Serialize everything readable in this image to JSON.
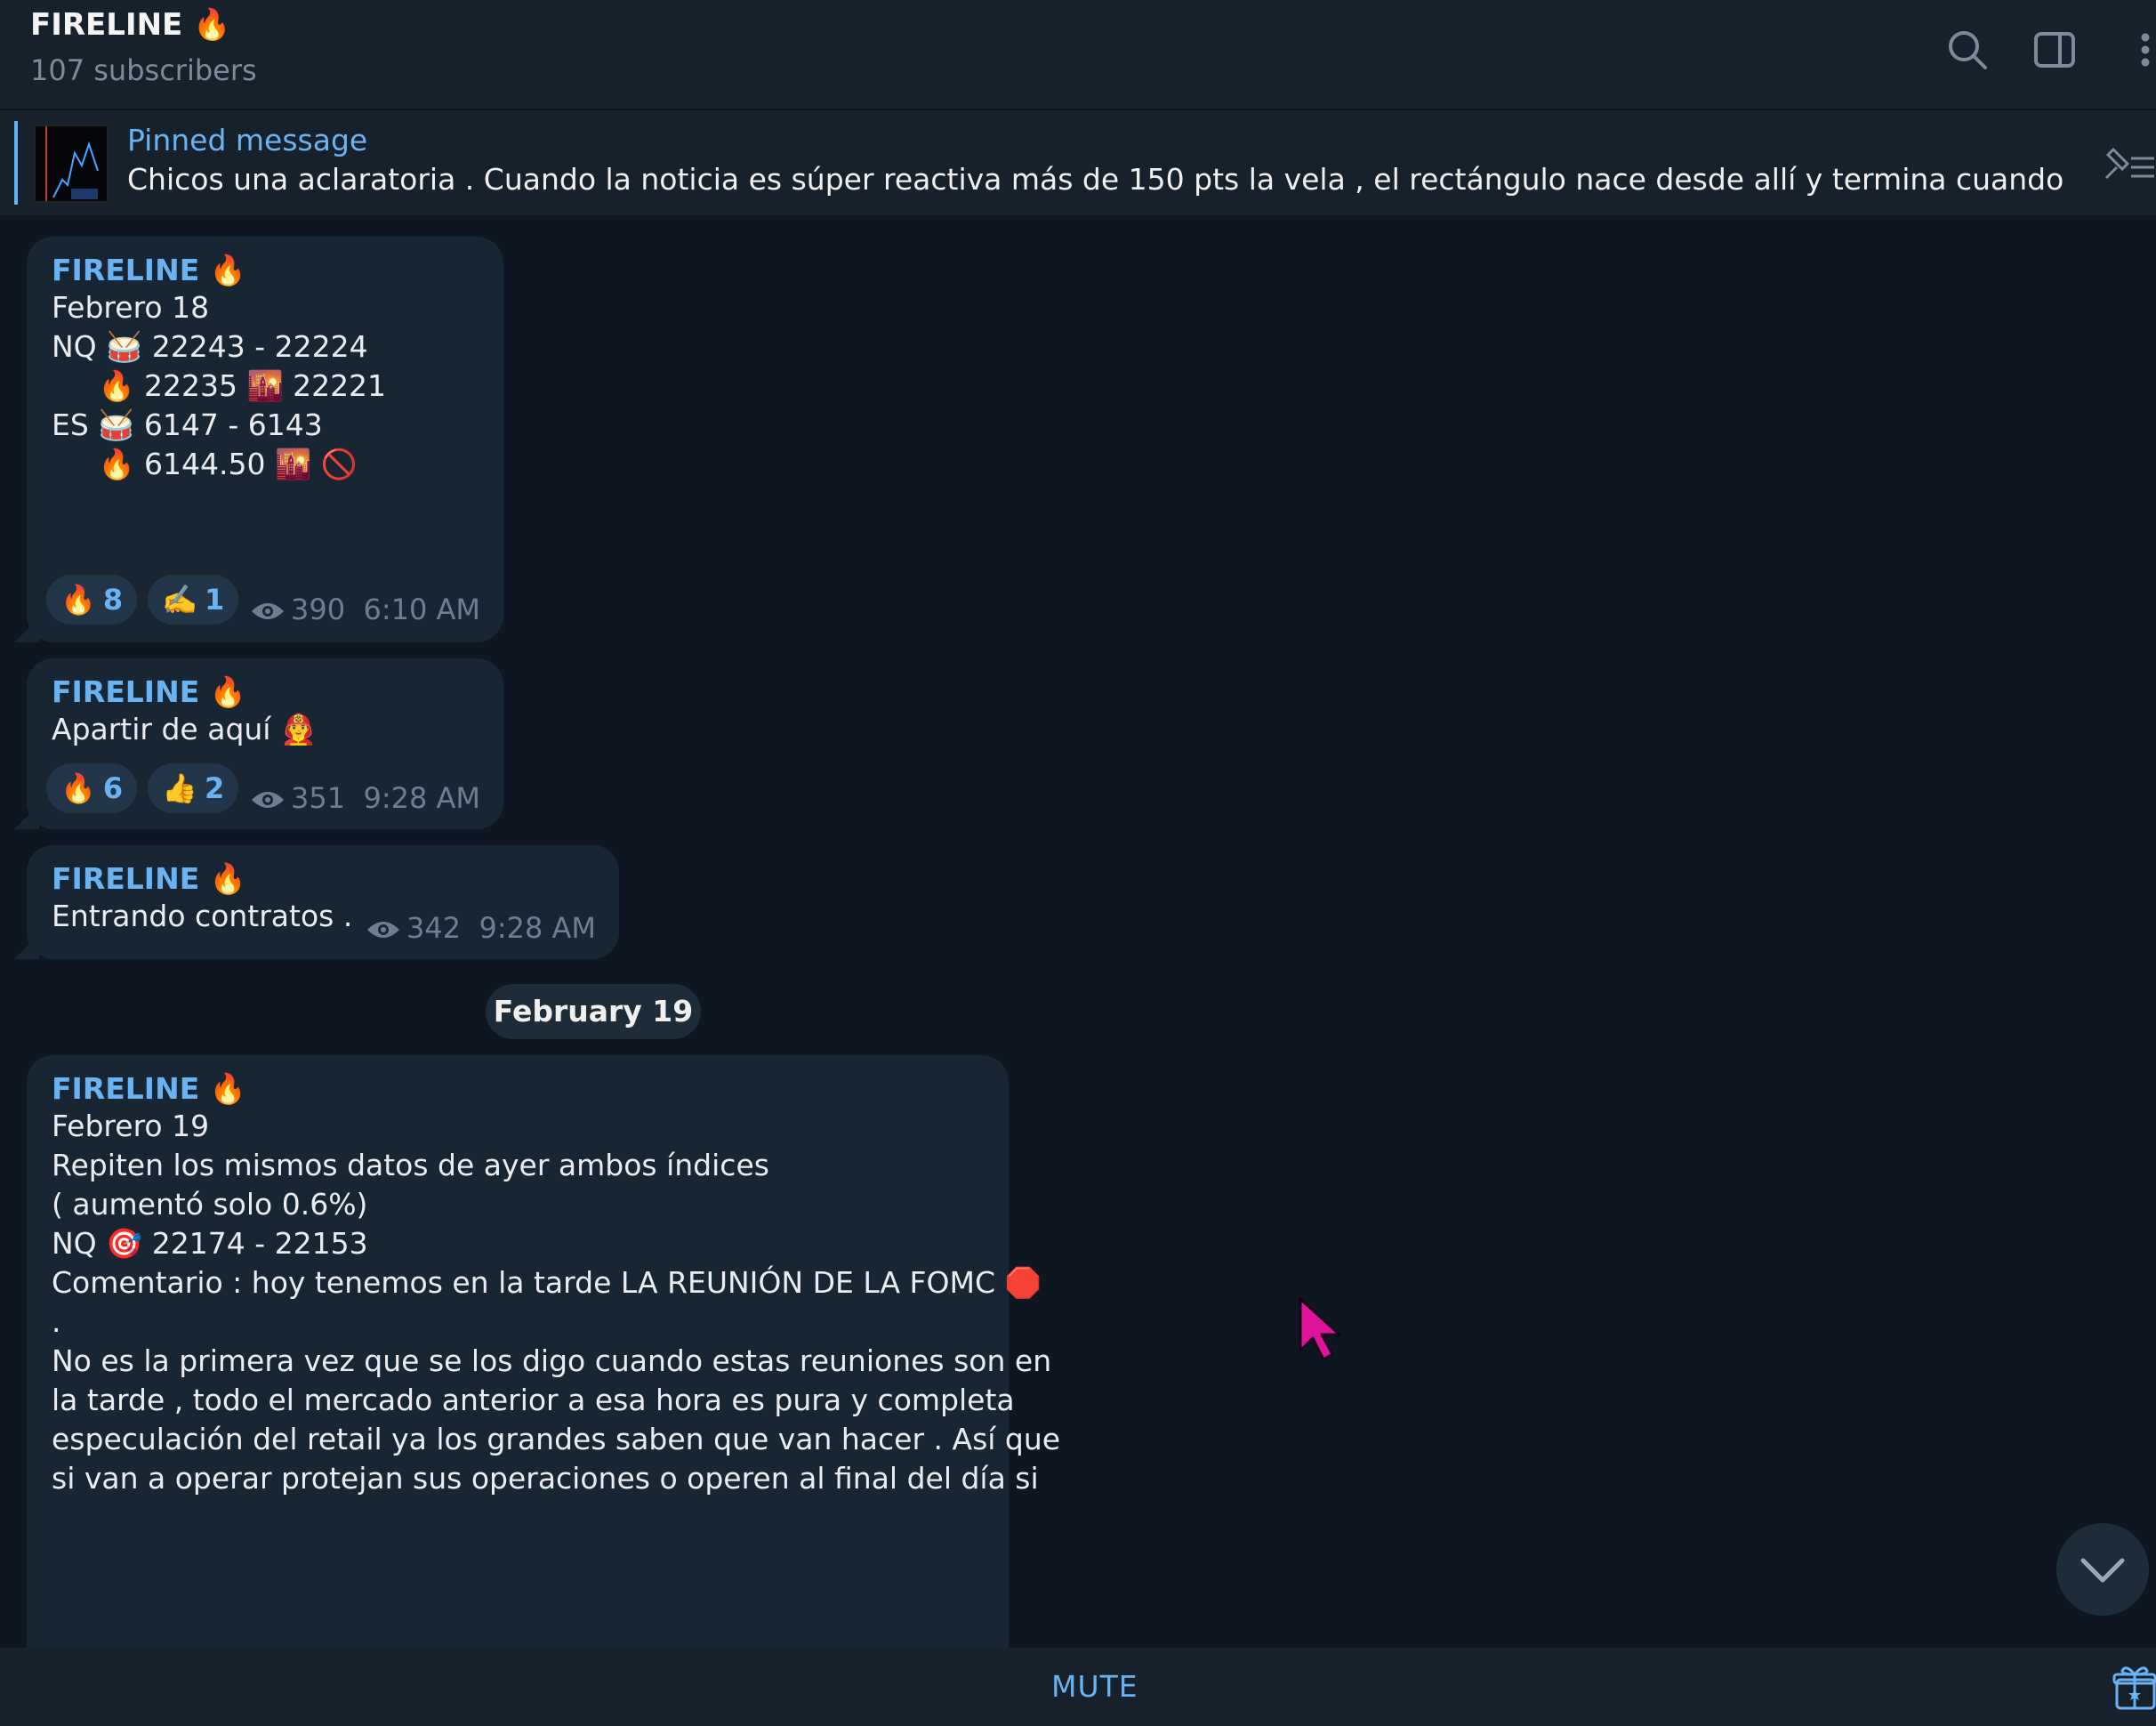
{
  "header": {
    "title": "FIRELINE 🔥",
    "subtitle": "107 subscribers",
    "icons": [
      "search-icon",
      "sidebar-toggle-icon",
      "more-vertical-icon"
    ]
  },
  "pinned": {
    "label": "Pinned message",
    "text": "Chicos una aclaratoria .  Cuando la noticia es súper reactiva más de 150 pts la vela , el rectángulo nace desde allí y termina cuando complete las..."
  },
  "messages": [
    {
      "author": "FIRELINE 🔥",
      "lines": [
        "Febrero 18",
        "",
        "NQ 🥁 22243 - 22224",
        "     🔥 22235 🌇 22221",
        "",
        "ES 🥁 6147 - 6143",
        "     🔥 6144.50 🌇 🚫"
      ],
      "reactions": [
        {
          "emoji": "🔥",
          "count": "8"
        },
        {
          "emoji": "✍️",
          "count": "1"
        }
      ],
      "views": "390",
      "time": "6:10 AM"
    },
    {
      "author": "FIRELINE 🔥",
      "lines": [
        "Apartir de aquí 👨‍🚒"
      ],
      "reactions": [
        {
          "emoji": "🔥",
          "count": "6"
        },
        {
          "emoji": "👍",
          "count": "2"
        }
      ],
      "views": "351",
      "time": "9:28 AM"
    },
    {
      "author": "FIRELINE 🔥",
      "lines": [
        "Entrando contratos ."
      ],
      "reactions": [],
      "views": "342",
      "time": "9:28 AM"
    },
    {
      "author": "FIRELINE 🔥",
      "lines": [
        "Febrero 19",
        "",
        "Repiten los mismos datos de ayer ambos índices",
        "( aumentó solo 0.6%)",
        "",
        "NQ 🎯 22174 - 22153",
        "",
        "Comentario : hoy tenemos en la tarde LA REUNIÓN DE LA FOMC 🛑",
        ".",
        "",
        "No es la primera vez que se los digo cuando estas reuniones son en",
        "la tarde , todo el mercado anterior a esa hora es pura y completa",
        "especulación del retail ya los grandes saben que van hacer . Así que",
        "si van a operar protejan sus operaciones o operen al final del día si"
      ]
    }
  ],
  "date_separator": "February 19",
  "footer": {
    "mute_label": "MUTE",
    "icons": [
      "gift-icon"
    ]
  },
  "colors": {
    "background": "#0e1621",
    "header": "#17212b",
    "bubble": "#182533",
    "accent": "#6ab3f3",
    "muted": "#6d7f8f"
  }
}
